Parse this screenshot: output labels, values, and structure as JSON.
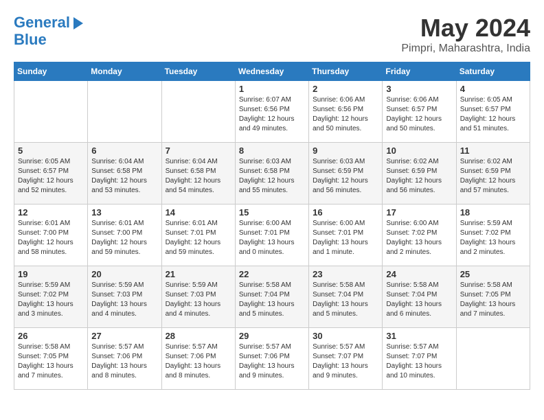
{
  "logo": {
    "line1": "General",
    "line2": "Blue"
  },
  "title": "May 2024",
  "location": "Pimpri, Maharashtra, India",
  "days_header": [
    "Sunday",
    "Monday",
    "Tuesday",
    "Wednesday",
    "Thursday",
    "Friday",
    "Saturday"
  ],
  "weeks": [
    [
      {
        "day": "",
        "info": ""
      },
      {
        "day": "",
        "info": ""
      },
      {
        "day": "",
        "info": ""
      },
      {
        "day": "1",
        "info": "Sunrise: 6:07 AM\nSunset: 6:56 PM\nDaylight: 12 hours\nand 49 minutes."
      },
      {
        "day": "2",
        "info": "Sunrise: 6:06 AM\nSunset: 6:56 PM\nDaylight: 12 hours\nand 50 minutes."
      },
      {
        "day": "3",
        "info": "Sunrise: 6:06 AM\nSunset: 6:57 PM\nDaylight: 12 hours\nand 50 minutes."
      },
      {
        "day": "4",
        "info": "Sunrise: 6:05 AM\nSunset: 6:57 PM\nDaylight: 12 hours\nand 51 minutes."
      }
    ],
    [
      {
        "day": "5",
        "info": "Sunrise: 6:05 AM\nSunset: 6:57 PM\nDaylight: 12 hours\nand 52 minutes."
      },
      {
        "day": "6",
        "info": "Sunrise: 6:04 AM\nSunset: 6:58 PM\nDaylight: 12 hours\nand 53 minutes."
      },
      {
        "day": "7",
        "info": "Sunrise: 6:04 AM\nSunset: 6:58 PM\nDaylight: 12 hours\nand 54 minutes."
      },
      {
        "day": "8",
        "info": "Sunrise: 6:03 AM\nSunset: 6:58 PM\nDaylight: 12 hours\nand 55 minutes."
      },
      {
        "day": "9",
        "info": "Sunrise: 6:03 AM\nSunset: 6:59 PM\nDaylight: 12 hours\nand 56 minutes."
      },
      {
        "day": "10",
        "info": "Sunrise: 6:02 AM\nSunset: 6:59 PM\nDaylight: 12 hours\nand 56 minutes."
      },
      {
        "day": "11",
        "info": "Sunrise: 6:02 AM\nSunset: 6:59 PM\nDaylight: 12 hours\nand 57 minutes."
      }
    ],
    [
      {
        "day": "12",
        "info": "Sunrise: 6:01 AM\nSunset: 7:00 PM\nDaylight: 12 hours\nand 58 minutes."
      },
      {
        "day": "13",
        "info": "Sunrise: 6:01 AM\nSunset: 7:00 PM\nDaylight: 12 hours\nand 59 minutes."
      },
      {
        "day": "14",
        "info": "Sunrise: 6:01 AM\nSunset: 7:01 PM\nDaylight: 12 hours\nand 59 minutes."
      },
      {
        "day": "15",
        "info": "Sunrise: 6:00 AM\nSunset: 7:01 PM\nDaylight: 13 hours\nand 0 minutes."
      },
      {
        "day": "16",
        "info": "Sunrise: 6:00 AM\nSunset: 7:01 PM\nDaylight: 13 hours\nand 1 minute."
      },
      {
        "day": "17",
        "info": "Sunrise: 6:00 AM\nSunset: 7:02 PM\nDaylight: 13 hours\nand 2 minutes."
      },
      {
        "day": "18",
        "info": "Sunrise: 5:59 AM\nSunset: 7:02 PM\nDaylight: 13 hours\nand 2 minutes."
      }
    ],
    [
      {
        "day": "19",
        "info": "Sunrise: 5:59 AM\nSunset: 7:02 PM\nDaylight: 13 hours\nand 3 minutes."
      },
      {
        "day": "20",
        "info": "Sunrise: 5:59 AM\nSunset: 7:03 PM\nDaylight: 13 hours\nand 4 minutes."
      },
      {
        "day": "21",
        "info": "Sunrise: 5:59 AM\nSunset: 7:03 PM\nDaylight: 13 hours\nand 4 minutes."
      },
      {
        "day": "22",
        "info": "Sunrise: 5:58 AM\nSunset: 7:04 PM\nDaylight: 13 hours\nand 5 minutes."
      },
      {
        "day": "23",
        "info": "Sunrise: 5:58 AM\nSunset: 7:04 PM\nDaylight: 13 hours\nand 5 minutes."
      },
      {
        "day": "24",
        "info": "Sunrise: 5:58 AM\nSunset: 7:04 PM\nDaylight: 13 hours\nand 6 minutes."
      },
      {
        "day": "25",
        "info": "Sunrise: 5:58 AM\nSunset: 7:05 PM\nDaylight: 13 hours\nand 7 minutes."
      }
    ],
    [
      {
        "day": "26",
        "info": "Sunrise: 5:58 AM\nSunset: 7:05 PM\nDaylight: 13 hours\nand 7 minutes."
      },
      {
        "day": "27",
        "info": "Sunrise: 5:57 AM\nSunset: 7:06 PM\nDaylight: 13 hours\nand 8 minutes."
      },
      {
        "day": "28",
        "info": "Sunrise: 5:57 AM\nSunset: 7:06 PM\nDaylight: 13 hours\nand 8 minutes."
      },
      {
        "day": "29",
        "info": "Sunrise: 5:57 AM\nSunset: 7:06 PM\nDaylight: 13 hours\nand 9 minutes."
      },
      {
        "day": "30",
        "info": "Sunrise: 5:57 AM\nSunset: 7:07 PM\nDaylight: 13 hours\nand 9 minutes."
      },
      {
        "day": "31",
        "info": "Sunrise: 5:57 AM\nSunset: 7:07 PM\nDaylight: 13 hours\nand 10 minutes."
      },
      {
        "day": "",
        "info": ""
      }
    ]
  ]
}
